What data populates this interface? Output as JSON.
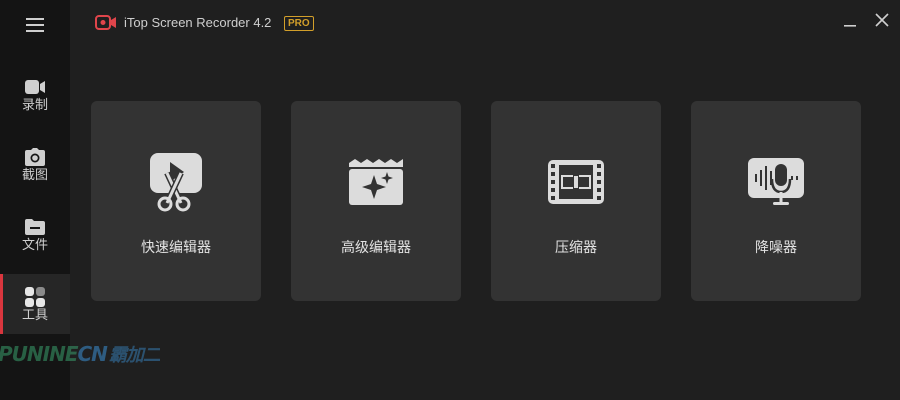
{
  "app": {
    "title": "iTop Screen Recorder 4.2",
    "badge": "PRO",
    "accent_color": "#d9363e",
    "badge_color": "#d29f2a"
  },
  "sidebar": {
    "menu_icon": "hamburger-menu-icon",
    "items": [
      {
        "label": "录制",
        "icon": "video-camera-icon",
        "active": false
      },
      {
        "label": "截图",
        "icon": "camera-icon",
        "active": false
      },
      {
        "label": "文件",
        "icon": "folder-icon",
        "active": false
      },
      {
        "label": "工具",
        "icon": "grid-tools-icon",
        "active": true
      }
    ]
  },
  "watermark": {
    "text_latin": "PUNINE",
    "text_cn": "CN",
    "text_cjk": "霸加二"
  },
  "tools": [
    {
      "label": "快速编辑器",
      "icon": "quick-editor-icon"
    },
    {
      "label": "高级编辑器",
      "icon": "advanced-editor-icon"
    },
    {
      "label": "压缩器",
      "icon": "compressor-icon"
    },
    {
      "label": "降噪器",
      "icon": "noise-reducer-icon"
    }
  ],
  "window_controls": {
    "minimize_icon": "minimize-icon",
    "close_icon": "close-icon"
  }
}
